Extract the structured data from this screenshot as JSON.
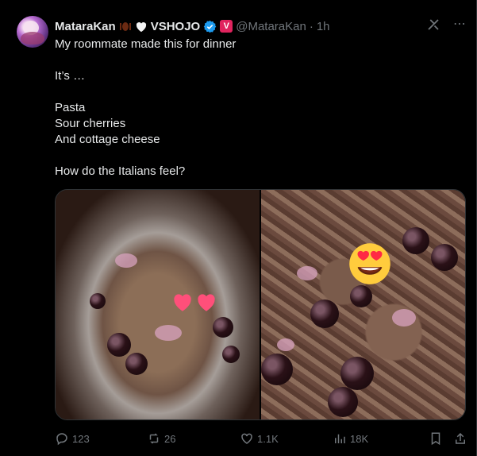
{
  "post": {
    "author_name": "MataraKan",
    "affiliation": "VSHOJO",
    "brand_badge": "V",
    "handle": "@MataraKan",
    "separator": "·",
    "time": "1h",
    "text": "My roommate made this for dinner\n\nIt’s …\n\nPasta\nSour cherries\nAnd cottage cheese\n\nHow do the Italians feel?"
  },
  "icons": {
    "bug": "bug-icon",
    "heart": "white-heart-icon",
    "verified": "verified-badge-icon",
    "grok": "grok-icon",
    "more": "more-icon",
    "reply": "reply-icon",
    "repost": "repost-icon",
    "like": "like-icon",
    "views": "views-icon",
    "bookmark": "bookmark-icon",
    "share": "share-icon"
  },
  "stats": {
    "replies": "123",
    "reposts": "26",
    "likes": "1.1K",
    "views": "18K"
  },
  "colors": {
    "background": "#000000",
    "text": "#e7e9ea",
    "muted": "#71767b",
    "verified": "#1d9bf0",
    "brand": "#e0245e"
  }
}
